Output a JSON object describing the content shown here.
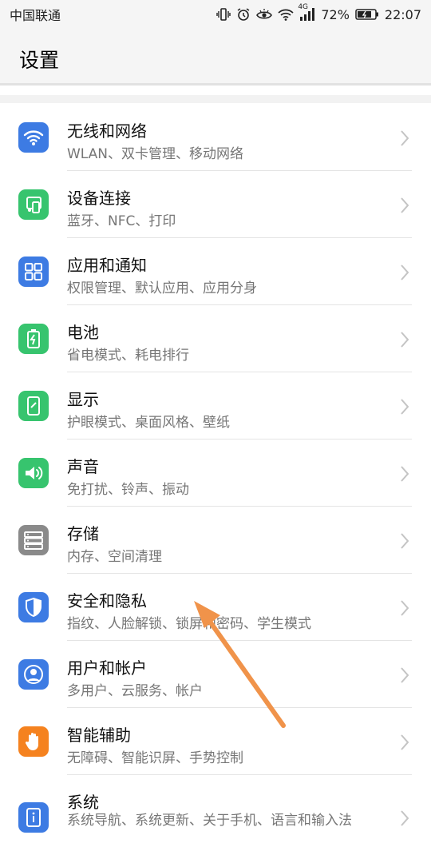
{
  "status_bar": {
    "carrier": "中国联通",
    "network_badge": "4G",
    "battery_percent": "72%",
    "time": "22:07",
    "icons": [
      "vibrate-icon",
      "alarm-icon",
      "eye-comfort-icon",
      "wifi-icon",
      "signal-icon",
      "battery-icon"
    ]
  },
  "header": {
    "title": "设置"
  },
  "colors": {
    "blue": "#3d7be3",
    "green": "#37c46e",
    "gray": "#8a8a8a",
    "orange": "#f5821f",
    "arrow": "#f0934a"
  },
  "items": [
    {
      "title": "无线和网络",
      "subtitle": "WLAN、双卡管理、移动网络",
      "icon": "wifi-icon",
      "color": "#3d7be3"
    },
    {
      "title": "设备连接",
      "subtitle": "蓝牙、NFC、打印",
      "icon": "device-connect-icon",
      "color": "#37c46e"
    },
    {
      "title": "应用和通知",
      "subtitle": "权限管理、默认应用、应用分身",
      "icon": "apps-grid-icon",
      "color": "#3d7be3"
    },
    {
      "title": "电池",
      "subtitle": "省电模式、耗电排行",
      "icon": "battery-icon",
      "color": "#37c46e"
    },
    {
      "title": "显示",
      "subtitle": "护眼模式、桌面风格、壁纸",
      "icon": "display-icon",
      "color": "#37c46e"
    },
    {
      "title": "声音",
      "subtitle": "免打扰、铃声、振动",
      "icon": "speaker-icon",
      "color": "#37c46e"
    },
    {
      "title": "存储",
      "subtitle": "内存、空间清理",
      "icon": "storage-icon",
      "color": "#8a8a8a"
    },
    {
      "title": "安全和隐私",
      "subtitle": "指纹、人脸解锁、锁屏和密码、学生模式",
      "icon": "shield-icon",
      "color": "#3d7be3"
    },
    {
      "title": "用户和帐户",
      "subtitle": "多用户、云服务、帐户",
      "icon": "user-icon",
      "color": "#3d7be3"
    },
    {
      "title": "智能辅助",
      "subtitle": "无障碍、智能识屏、手势控制",
      "icon": "hand-icon",
      "color": "#f5821f"
    },
    {
      "title": "系统",
      "subtitle": "系统导航、系统更新、关于手机、语言和输入法",
      "icon": "info-icon",
      "color": "#3d7be3"
    }
  ]
}
